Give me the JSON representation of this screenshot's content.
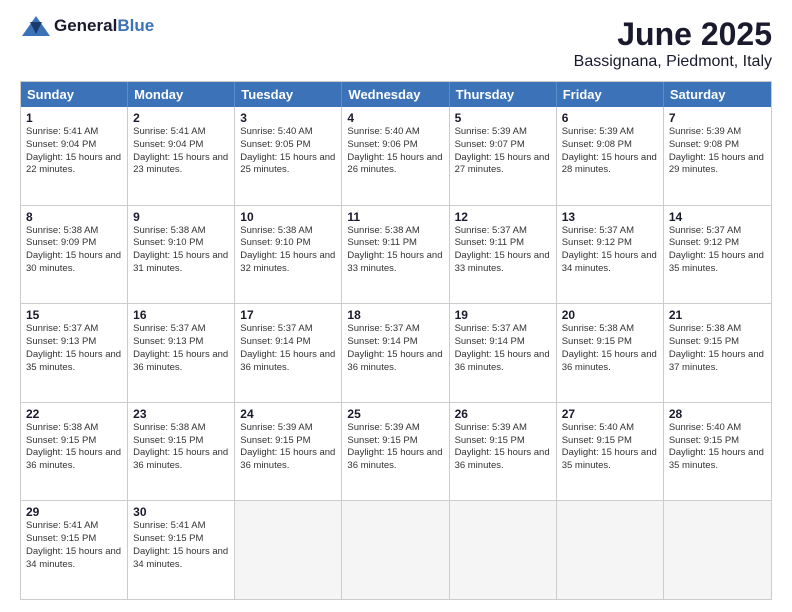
{
  "logo": {
    "text_general": "General",
    "text_blue": "Blue"
  },
  "title": "June 2025",
  "subtitle": "Bassignana, Piedmont, Italy",
  "header": {
    "days": [
      "Sunday",
      "Monday",
      "Tuesday",
      "Wednesday",
      "Thursday",
      "Friday",
      "Saturday"
    ]
  },
  "rows": [
    [
      {
        "day": "1",
        "sunrise": "Sunrise: 5:41 AM",
        "sunset": "Sunset: 9:04 PM",
        "daylight": "Daylight: 15 hours and 22 minutes."
      },
      {
        "day": "2",
        "sunrise": "Sunrise: 5:41 AM",
        "sunset": "Sunset: 9:04 PM",
        "daylight": "Daylight: 15 hours and 23 minutes."
      },
      {
        "day": "3",
        "sunrise": "Sunrise: 5:40 AM",
        "sunset": "Sunset: 9:05 PM",
        "daylight": "Daylight: 15 hours and 25 minutes."
      },
      {
        "day": "4",
        "sunrise": "Sunrise: 5:40 AM",
        "sunset": "Sunset: 9:06 PM",
        "daylight": "Daylight: 15 hours and 26 minutes."
      },
      {
        "day": "5",
        "sunrise": "Sunrise: 5:39 AM",
        "sunset": "Sunset: 9:07 PM",
        "daylight": "Daylight: 15 hours and 27 minutes."
      },
      {
        "day": "6",
        "sunrise": "Sunrise: 5:39 AM",
        "sunset": "Sunset: 9:08 PM",
        "daylight": "Daylight: 15 hours and 28 minutes."
      },
      {
        "day": "7",
        "sunrise": "Sunrise: 5:39 AM",
        "sunset": "Sunset: 9:08 PM",
        "daylight": "Daylight: 15 hours and 29 minutes."
      }
    ],
    [
      {
        "day": "8",
        "sunrise": "Sunrise: 5:38 AM",
        "sunset": "Sunset: 9:09 PM",
        "daylight": "Daylight: 15 hours and 30 minutes."
      },
      {
        "day": "9",
        "sunrise": "Sunrise: 5:38 AM",
        "sunset": "Sunset: 9:10 PM",
        "daylight": "Daylight: 15 hours and 31 minutes."
      },
      {
        "day": "10",
        "sunrise": "Sunrise: 5:38 AM",
        "sunset": "Sunset: 9:10 PM",
        "daylight": "Daylight: 15 hours and 32 minutes."
      },
      {
        "day": "11",
        "sunrise": "Sunrise: 5:38 AM",
        "sunset": "Sunset: 9:11 PM",
        "daylight": "Daylight: 15 hours and 33 minutes."
      },
      {
        "day": "12",
        "sunrise": "Sunrise: 5:37 AM",
        "sunset": "Sunset: 9:11 PM",
        "daylight": "Daylight: 15 hours and 33 minutes."
      },
      {
        "day": "13",
        "sunrise": "Sunrise: 5:37 AM",
        "sunset": "Sunset: 9:12 PM",
        "daylight": "Daylight: 15 hours and 34 minutes."
      },
      {
        "day": "14",
        "sunrise": "Sunrise: 5:37 AM",
        "sunset": "Sunset: 9:12 PM",
        "daylight": "Daylight: 15 hours and 35 minutes."
      }
    ],
    [
      {
        "day": "15",
        "sunrise": "Sunrise: 5:37 AM",
        "sunset": "Sunset: 9:13 PM",
        "daylight": "Daylight: 15 hours and 35 minutes."
      },
      {
        "day": "16",
        "sunrise": "Sunrise: 5:37 AM",
        "sunset": "Sunset: 9:13 PM",
        "daylight": "Daylight: 15 hours and 36 minutes."
      },
      {
        "day": "17",
        "sunrise": "Sunrise: 5:37 AM",
        "sunset": "Sunset: 9:14 PM",
        "daylight": "Daylight: 15 hours and 36 minutes."
      },
      {
        "day": "18",
        "sunrise": "Sunrise: 5:37 AM",
        "sunset": "Sunset: 9:14 PM",
        "daylight": "Daylight: 15 hours and 36 minutes."
      },
      {
        "day": "19",
        "sunrise": "Sunrise: 5:37 AM",
        "sunset": "Sunset: 9:14 PM",
        "daylight": "Daylight: 15 hours and 36 minutes."
      },
      {
        "day": "20",
        "sunrise": "Sunrise: 5:38 AM",
        "sunset": "Sunset: 9:15 PM",
        "daylight": "Daylight: 15 hours and 36 minutes."
      },
      {
        "day": "21",
        "sunrise": "Sunrise: 5:38 AM",
        "sunset": "Sunset: 9:15 PM",
        "daylight": "Daylight: 15 hours and 37 minutes."
      }
    ],
    [
      {
        "day": "22",
        "sunrise": "Sunrise: 5:38 AM",
        "sunset": "Sunset: 9:15 PM",
        "daylight": "Daylight: 15 hours and 36 minutes."
      },
      {
        "day": "23",
        "sunrise": "Sunrise: 5:38 AM",
        "sunset": "Sunset: 9:15 PM",
        "daylight": "Daylight: 15 hours and 36 minutes."
      },
      {
        "day": "24",
        "sunrise": "Sunrise: 5:39 AM",
        "sunset": "Sunset: 9:15 PM",
        "daylight": "Daylight: 15 hours and 36 minutes."
      },
      {
        "day": "25",
        "sunrise": "Sunrise: 5:39 AM",
        "sunset": "Sunset: 9:15 PM",
        "daylight": "Daylight: 15 hours and 36 minutes."
      },
      {
        "day": "26",
        "sunrise": "Sunrise: 5:39 AM",
        "sunset": "Sunset: 9:15 PM",
        "daylight": "Daylight: 15 hours and 36 minutes."
      },
      {
        "day": "27",
        "sunrise": "Sunrise: 5:40 AM",
        "sunset": "Sunset: 9:15 PM",
        "daylight": "Daylight: 15 hours and 35 minutes."
      },
      {
        "day": "28",
        "sunrise": "Sunrise: 5:40 AM",
        "sunset": "Sunset: 9:15 PM",
        "daylight": "Daylight: 15 hours and 35 minutes."
      }
    ],
    [
      {
        "day": "29",
        "sunrise": "Sunrise: 5:41 AM",
        "sunset": "Sunset: 9:15 PM",
        "daylight": "Daylight: 15 hours and 34 minutes."
      },
      {
        "day": "30",
        "sunrise": "Sunrise: 5:41 AM",
        "sunset": "Sunset: 9:15 PM",
        "daylight": "Daylight: 15 hours and 34 minutes."
      },
      {
        "day": "",
        "sunrise": "",
        "sunset": "",
        "daylight": ""
      },
      {
        "day": "",
        "sunrise": "",
        "sunset": "",
        "daylight": ""
      },
      {
        "day": "",
        "sunrise": "",
        "sunset": "",
        "daylight": ""
      },
      {
        "day": "",
        "sunrise": "",
        "sunset": "",
        "daylight": ""
      },
      {
        "day": "",
        "sunrise": "",
        "sunset": "",
        "daylight": ""
      }
    ]
  ]
}
